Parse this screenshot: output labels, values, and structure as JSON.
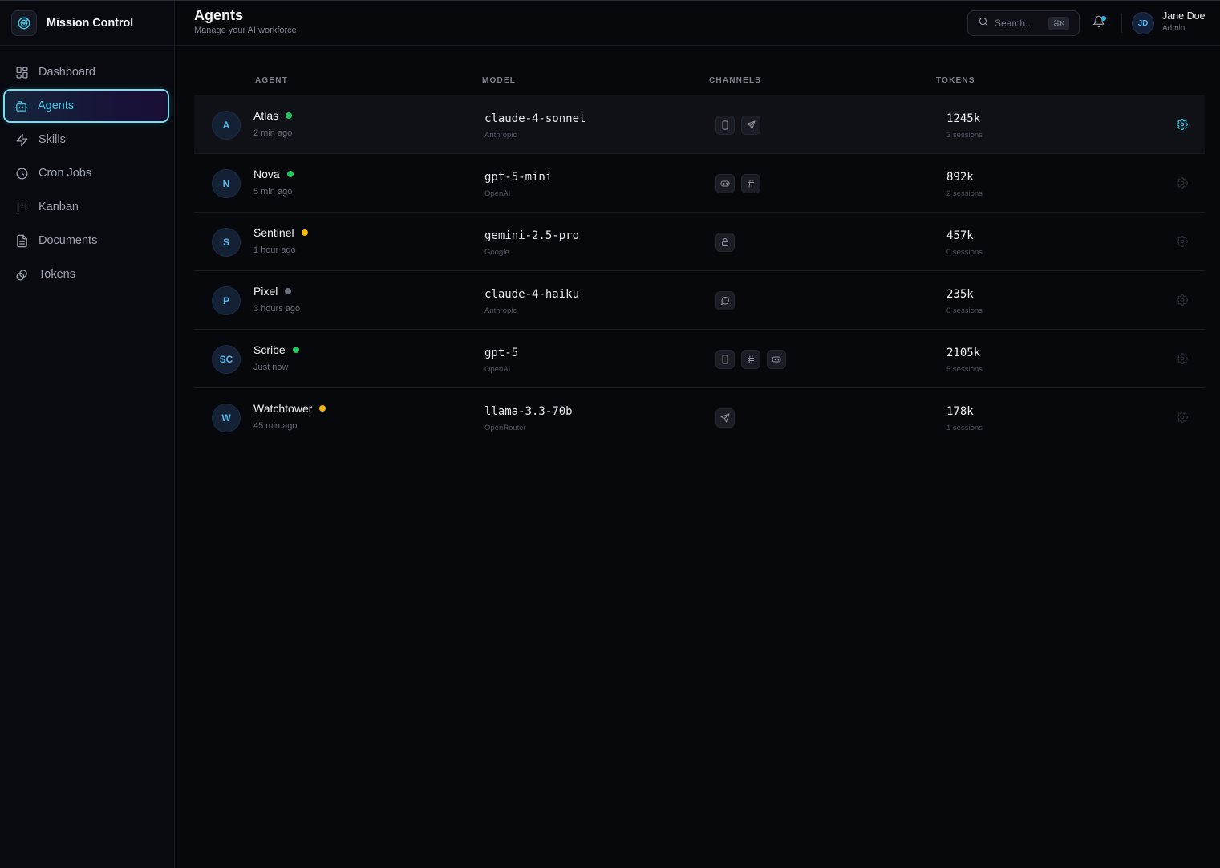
{
  "app": {
    "name": "Mission Control"
  },
  "sidebar": {
    "items": [
      {
        "label": "Dashboard",
        "icon": "dashboard-icon"
      },
      {
        "label": "Agents",
        "icon": "bot-icon",
        "active": true
      },
      {
        "label": "Skills",
        "icon": "lightning-icon"
      },
      {
        "label": "Cron Jobs",
        "icon": "clock-icon"
      },
      {
        "label": "Kanban",
        "icon": "kanban-icon"
      },
      {
        "label": "Documents",
        "icon": "document-icon"
      },
      {
        "label": "Tokens",
        "icon": "coins-icon"
      }
    ]
  },
  "header": {
    "title": "Agents",
    "subtitle": "Manage your AI workforce",
    "search_placeholder": "Search...",
    "search_shortcut": "⌘K",
    "user": {
      "initials": "JD",
      "name": "Jane Doe",
      "role": "Admin"
    }
  },
  "table": {
    "columns": [
      "AGENT",
      "MODEL",
      "CHANNELS",
      "TOKENS"
    ],
    "rows": [
      {
        "initials": "A",
        "name": "Atlas",
        "status": "online",
        "time": "2 min ago",
        "model": "claude-4-sonnet",
        "provider": "Anthropic",
        "channels": [
          "phone-icon",
          "send-icon"
        ],
        "tokens": "1245k",
        "sessions": "3 sessions"
      },
      {
        "initials": "N",
        "name": "Nova",
        "status": "online",
        "time": "5 min ago",
        "model": "gpt-5-mini",
        "provider": "OpenAI",
        "channels": [
          "gamepad-icon",
          "hash-icon"
        ],
        "tokens": "892k",
        "sessions": "2 sessions"
      },
      {
        "initials": "S",
        "name": "Sentinel",
        "status": "idle",
        "time": "1 hour ago",
        "model": "gemini-2.5-pro",
        "provider": "Google",
        "channels": [
          "lock-icon"
        ],
        "tokens": "457k",
        "sessions": "0 sessions"
      },
      {
        "initials": "P",
        "name": "Pixel",
        "status": "offline",
        "time": "3 hours ago",
        "model": "claude-4-haiku",
        "provider": "Anthropic",
        "channels": [
          "chat-bubble-icon"
        ],
        "tokens": "235k",
        "sessions": "0 sessions"
      },
      {
        "initials": "SC",
        "name": "Scribe",
        "status": "online",
        "time": "Just now",
        "model": "gpt-5",
        "provider": "OpenAI",
        "channels": [
          "phone-icon",
          "hash-icon",
          "gamepad-icon"
        ],
        "tokens": "2105k",
        "sessions": "5 sessions"
      },
      {
        "initials": "W",
        "name": "Watchtower",
        "status": "idle",
        "time": "45 min ago",
        "model": "llama-3.3-70b",
        "provider": "OpenRouter",
        "channels": [
          "send-icon"
        ],
        "tokens": "178k",
        "sessions": "1 sessions"
      }
    ]
  },
  "colors": {
    "accent": "#3fc6e4",
    "status_online": "#22c55e",
    "status_idle": "#f5b400",
    "status_offline": "#6b7280"
  }
}
